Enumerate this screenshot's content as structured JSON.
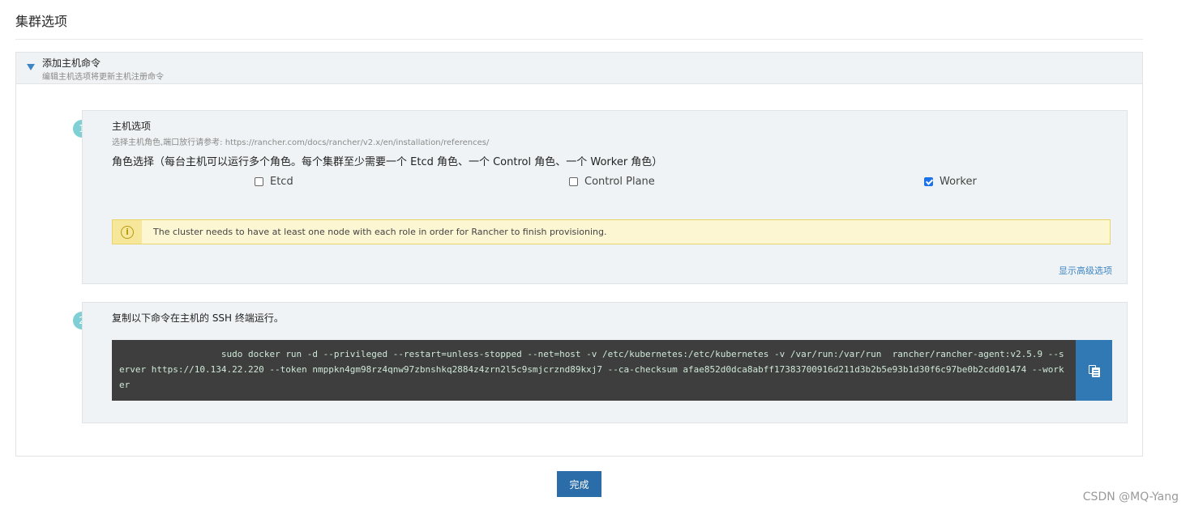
{
  "page": {
    "title": "集群选项"
  },
  "panel": {
    "title": "添加主机命令",
    "subtitle": "编辑主机选项将更新主机注册命令"
  },
  "step1": {
    "number": "1",
    "heading": "主机选项",
    "description": "选择主机角色,端口放行请参考: https://rancher.com/docs/rancher/v2.x/en/installation/references/",
    "roles_label": "角色选择（每台主机可以运行多个角色。每个集群至少需要一个 Etcd 角色、一个 Control 角色、一个 Worker 角色）",
    "roles": [
      {
        "label": "Etcd",
        "checked": false
      },
      {
        "label": "Control Plane",
        "checked": false
      },
      {
        "label": "Worker",
        "checked": true
      }
    ],
    "warning": "The cluster needs to have at least one node with each role in order for Rancher to finish provisioning.",
    "warning_icon": "info-circle-icon",
    "advanced_link": "显示高级选项"
  },
  "step2": {
    "number": "2",
    "heading": "复制以下命令在主机的 SSH 终端运行。",
    "command": "                   sudo docker run -d --privileged --restart=unless-stopped --net=host -v /etc/kubernetes:/etc/kubernetes -v /var/run:/var/run  rancher/rancher-agent:v2.5.9 --server https://10.134.22.220 --token nmppkn4gm98rz4qnw97zbnshkq2884z4zrn2l5c9smjcrznd89kxj7 --ca-checksum afae852d0dca8abff17383700916d211d3b2b5e93b1d30f6c97be0b2cdd01474 --worker",
    "copy_icon": "clipboard-icon"
  },
  "footer": {
    "done_label": "完成"
  },
  "watermark": "CSDN @MQ-Yang",
  "colors": {
    "accent": "#3179b5",
    "badge": "#7fcfd5",
    "warning_border": "#e9d46a",
    "warning_bg": "#fdf6d3",
    "code_bg": "#3e3e3e"
  }
}
